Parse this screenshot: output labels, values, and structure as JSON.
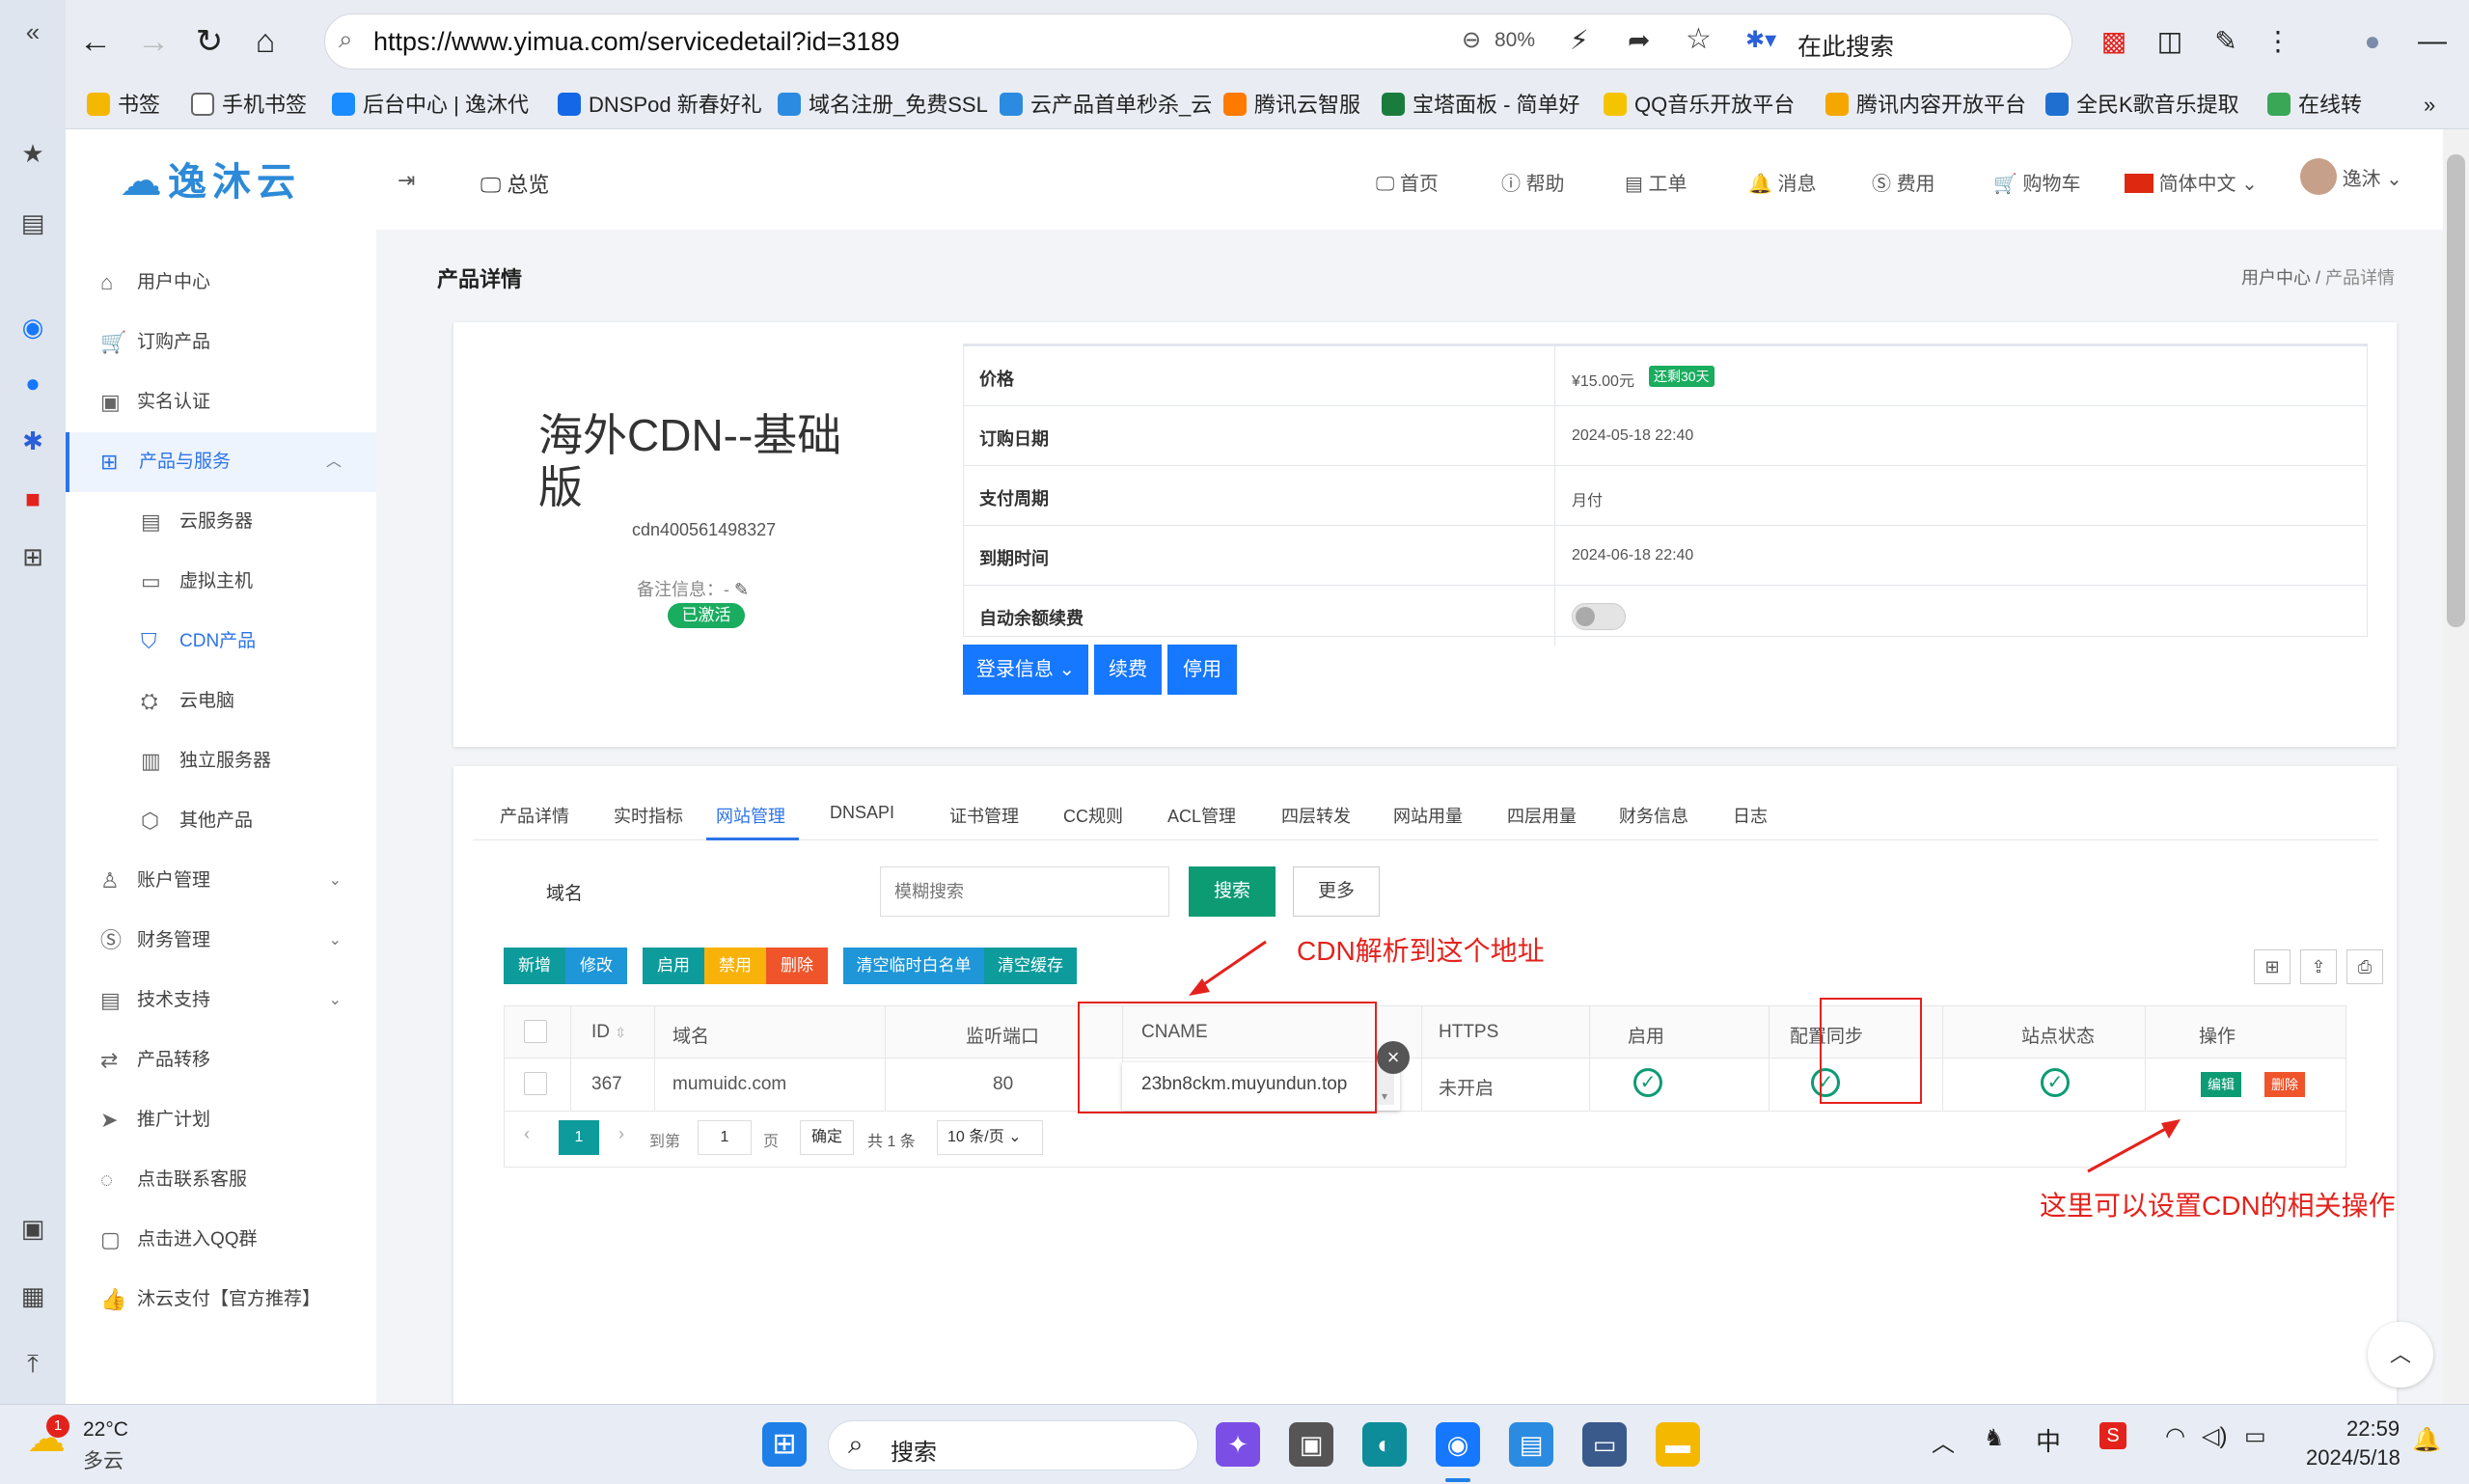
{
  "browser": {
    "url": "https://www.yimua.com/servicedetail?id=3189",
    "zoom": "80%",
    "search_placeholder": "在此搜索",
    "bookmarks": [
      "书签",
      "手机书签",
      "后台中心 | 逸沐代",
      "DNSPod 新春好礼",
      "域名注册_免费SSL",
      "云产品首单秒杀_云",
      "腾讯云智服",
      "宝塔面板 - 简单好",
      "QQ音乐开放平台",
      "腾讯内容开放平台",
      "全民K歌音乐提取",
      "在线转"
    ],
    "colors": {
      "bookmark_icons": [
        "#f5b800",
        "#666666",
        "#1a8cff",
        "#1467e6",
        "#2b8be0",
        "#2b8be0",
        "#ff7a00",
        "#1a7c3c",
        "#f5c400",
        "#f5a700",
        "#1f6fd1",
        "#3aa757"
      ]
    }
  },
  "header": {
    "logo": "逸沐云",
    "overview": "总览",
    "nav": [
      "首页",
      "帮助",
      "工单",
      "消息",
      "费用",
      "购物车",
      "简体中文",
      "逸沐"
    ]
  },
  "sidebar": {
    "items": [
      {
        "icon": "home-icon",
        "label": "用户中心"
      },
      {
        "icon": "cart-icon",
        "label": "订购产品"
      },
      {
        "icon": "id-card-icon",
        "label": "实名认证"
      },
      {
        "icon": "grid-icon",
        "label": "产品与服务"
      }
    ],
    "sub_items": [
      {
        "icon": "server-icon",
        "label": "云服务器"
      },
      {
        "icon": "disk-icon",
        "label": "虚拟主机"
      },
      {
        "icon": "shield-icon",
        "label": "CDN产品"
      },
      {
        "icon": "pc-icon",
        "label": "云电脑"
      },
      {
        "icon": "rack-icon",
        "label": "独立服务器"
      },
      {
        "icon": "box-icon",
        "label": "其他产品"
      }
    ],
    "items2": [
      {
        "icon": "user-icon",
        "label": "账户管理"
      },
      {
        "icon": "dollar-icon",
        "label": "财务管理"
      },
      {
        "icon": "support-icon",
        "label": "技术支持"
      },
      {
        "icon": "transfer-icon",
        "label": "产品转移"
      },
      {
        "icon": "send-icon",
        "label": "推广计划"
      },
      {
        "icon": "chat-icon",
        "label": "点击联系客服"
      },
      {
        "icon": "qq-icon",
        "label": "点击进入QQ群"
      },
      {
        "icon": "thumb-icon",
        "label": "沐云支付【官方推荐】"
      }
    ]
  },
  "page": {
    "title": "产品详情",
    "breadcrumb": [
      "用户中心",
      "产品详情"
    ]
  },
  "product": {
    "name": "海外CDN--基础版",
    "id": "cdn400561498327",
    "note_label": "备注信息：",
    "note_value": "-",
    "status": "已激活",
    "info": [
      {
        "label": "价格",
        "value": "¥15.00元",
        "badge": "还剩30天"
      },
      {
        "label": "订购日期",
        "value": "2024-05-18 22:40"
      },
      {
        "label": "支付周期",
        "value": "月付"
      },
      {
        "label": "到期时间",
        "value": "2024-06-18 22:40"
      },
      {
        "label": "自动余额续费",
        "value": ""
      }
    ],
    "buttons": [
      "登录信息",
      "续费",
      "停用"
    ]
  },
  "tabs": [
    "产品详情",
    "实时指标",
    "网站管理",
    "DNSAPI",
    "证书管理",
    "CC规则",
    "ACL管理",
    "四层转发",
    "网站用量",
    "四层用量",
    "财务信息",
    "日志"
  ],
  "filter": {
    "label": "域名",
    "placeholder": "模糊搜索",
    "search": "搜索",
    "more": "更多"
  },
  "actions": [
    "新增",
    "修改",
    "启用",
    "禁用",
    "删除",
    "清空临时白名单",
    "清空缓存"
  ],
  "table": {
    "headers": [
      "ID",
      "域名",
      "监听端口",
      "CNAME",
      "HTTPS",
      "启用",
      "配置同步",
      "站点状态",
      "操作"
    ],
    "rows": [
      {
        "id": "367",
        "domain": "mumuidc.com",
        "port": "80",
        "cname": "23bn8ckm.muyundun.top",
        "https": "未开启",
        "edit": "编辑",
        "delete": "删除"
      }
    ]
  },
  "pager": {
    "page": "1",
    "goto": "到第",
    "page_input": "1",
    "page_unit": "页",
    "confirm": "确定",
    "total": "共 1 条",
    "per_page": "10 条/页"
  },
  "annotations": {
    "cname_note": "CDN解析到这个地址",
    "op_note": "这里可以设置CDN的相关操作"
  },
  "taskbar": {
    "temp": "22°C",
    "weather": "多云",
    "weather_badge": "1",
    "search": "搜索",
    "ime": "中",
    "time": "22:59",
    "date": "2024/5/18"
  }
}
